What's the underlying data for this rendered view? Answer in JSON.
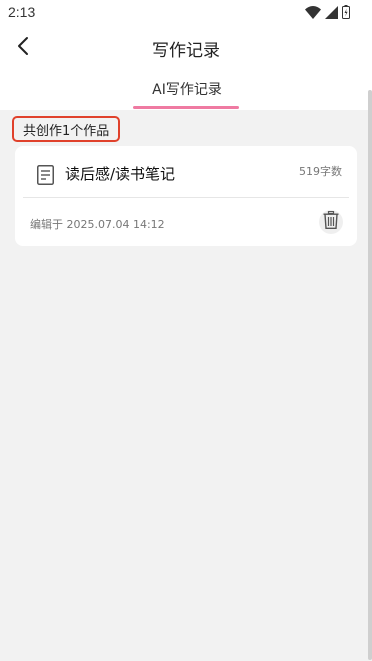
{
  "status_bar": {
    "time": "2:13",
    "icons": [
      "wifi-icon",
      "cellular-signal-icon",
      "battery-icon"
    ]
  },
  "header": {
    "title": "写作记录",
    "back_icon": "chevron-left-icon"
  },
  "tabs": [
    {
      "label": "AI写作记录",
      "active": true
    }
  ],
  "summary": {
    "count_text": "共创作1个作品"
  },
  "works": [
    {
      "icon": "document-icon",
      "title": "读后感/读书笔记",
      "word_count": "519字数",
      "edited": "编辑于 2025.07.04 14:12",
      "delete_icon": "trash-icon"
    }
  ],
  "colors": {
    "accent_tab": "#ef7aa2",
    "highlight_border": "#e0412b",
    "background": "#f2f2f2"
  }
}
